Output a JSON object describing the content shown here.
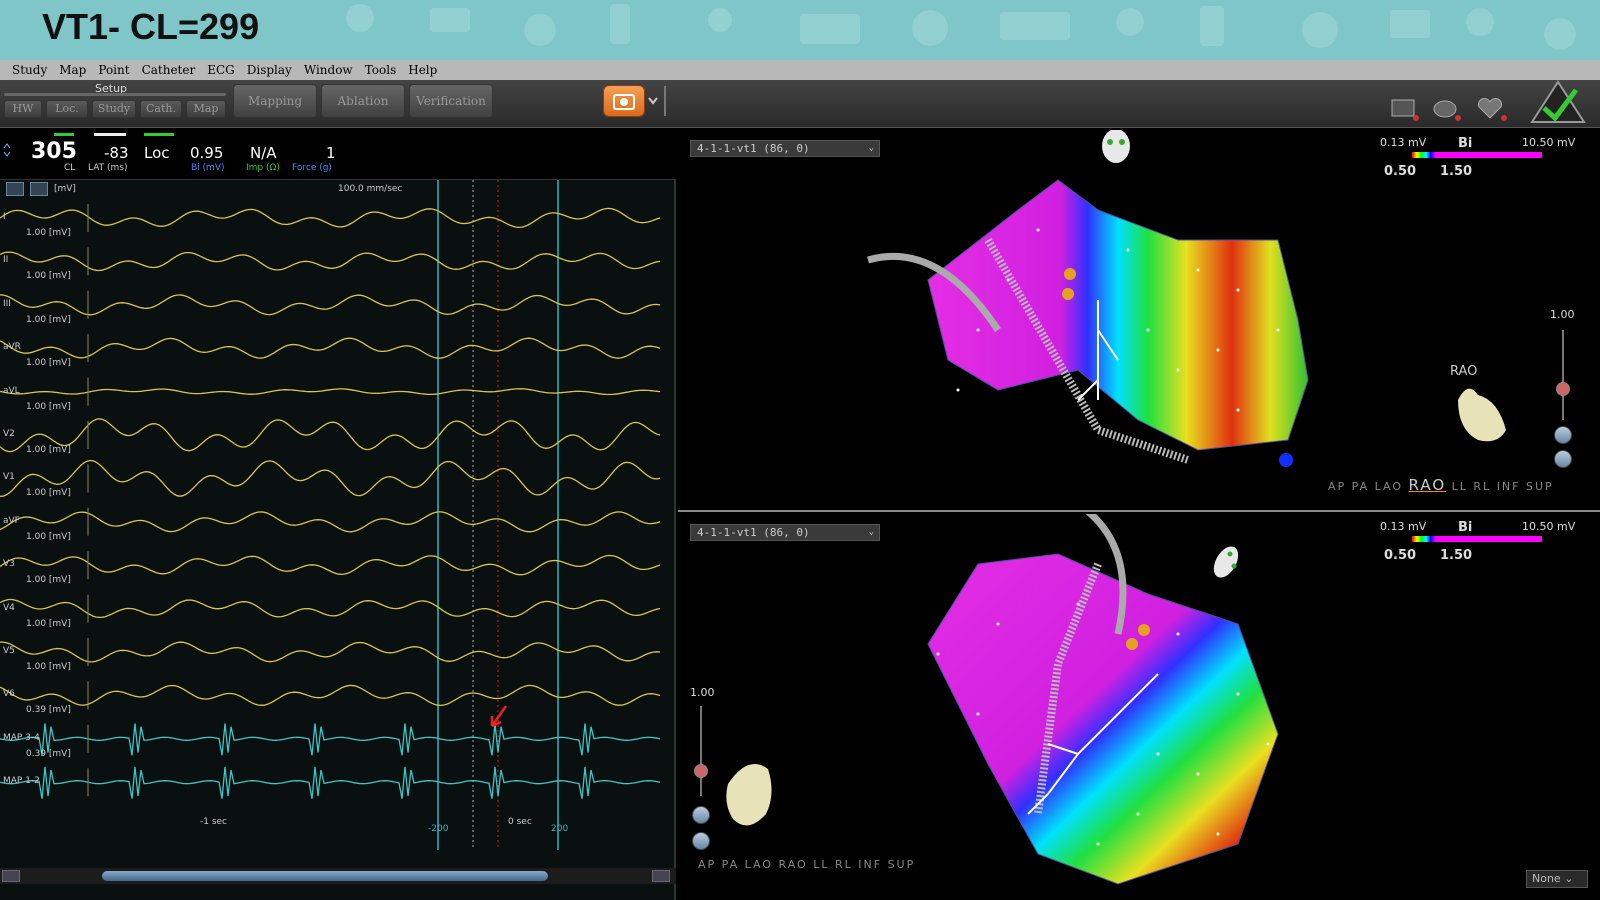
{
  "banner": {
    "title": "VT1-  CL=299"
  },
  "menu": [
    "Study",
    "Map",
    "Point",
    "Catheter",
    "ECG",
    "Display",
    "Window",
    "Tools",
    "Help"
  ],
  "toolbar": {
    "setup_label": "Setup",
    "setup_tabs": [
      "HW",
      "Loc.",
      "Study",
      "Cath.",
      "Map"
    ],
    "phases": [
      "Mapping",
      "Ablation",
      "Verification"
    ]
  },
  "info": {
    "cl": "305",
    "cl_label": "CL",
    "lat": "-83",
    "lat_label": "LAT (ms)",
    "loc": "Loc",
    "bi": "0.95",
    "bi_label": "Bi (mV)",
    "imp": "N/A",
    "imp_label": "Imp (Ω)",
    "force": "1",
    "force_label": "Force (g)"
  },
  "ecg": {
    "speed": "100.0 mm/sec",
    "unit": "[mV]",
    "traces": [
      {
        "name": "I",
        "scale": "1.00"
      },
      {
        "name": "II",
        "scale": "1.00"
      },
      {
        "name": "III",
        "scale": "1.00"
      },
      {
        "name": "aVR",
        "scale": "1.00"
      },
      {
        "name": "aVL",
        "scale": "1.00"
      },
      {
        "name": "V2",
        "scale": "1.00"
      },
      {
        "name": "V1",
        "scale": "1.00"
      },
      {
        "name": "aVF",
        "scale": "1.00"
      },
      {
        "name": "V3",
        "scale": "1.00"
      },
      {
        "name": "V4",
        "scale": "1.00"
      },
      {
        "name": "V5",
        "scale": "1.00"
      },
      {
        "name": "V6",
        "scale": "0.39"
      },
      {
        "name": "MAP 3-4",
        "scale": "0.39"
      },
      {
        "name": "MAP 1-2",
        "scale": ""
      }
    ],
    "time_labels": [
      "-1 sec",
      "-200",
      "0 sec",
      "200"
    ]
  },
  "map_top": {
    "selector": "4-1-1-vt1 (86, 0)",
    "legend_min": "0.13 mV",
    "legend_type": "Bi",
    "legend_max": "10.50 mV",
    "legend_low": "0.50",
    "legend_high": "1.50",
    "zoom": "1.00",
    "orientation_label": "RAO",
    "views": [
      "AP",
      "PA",
      "LAO",
      "RAO",
      "LL",
      "RL",
      "INF",
      "SUP"
    ],
    "active_view": "RAO"
  },
  "map_bottom": {
    "selector": "4-1-1-vt1 (86, 0)",
    "legend_min": "0.13 mV",
    "legend_type": "Bi",
    "legend_max": "10.50 mV",
    "legend_low": "0.50",
    "legend_high": "1.50",
    "zoom": "1.00",
    "views": [
      "AP",
      "PA",
      "LAO",
      "RAO",
      "LL",
      "RL",
      "INF",
      "SUP"
    ],
    "none_select": "None"
  },
  "colors": {
    "ecg_trace": "#d7c84a",
    "map_trace": "#3cc6c8",
    "banner": "#7fc6c8",
    "marker": "#2fb7c3"
  }
}
